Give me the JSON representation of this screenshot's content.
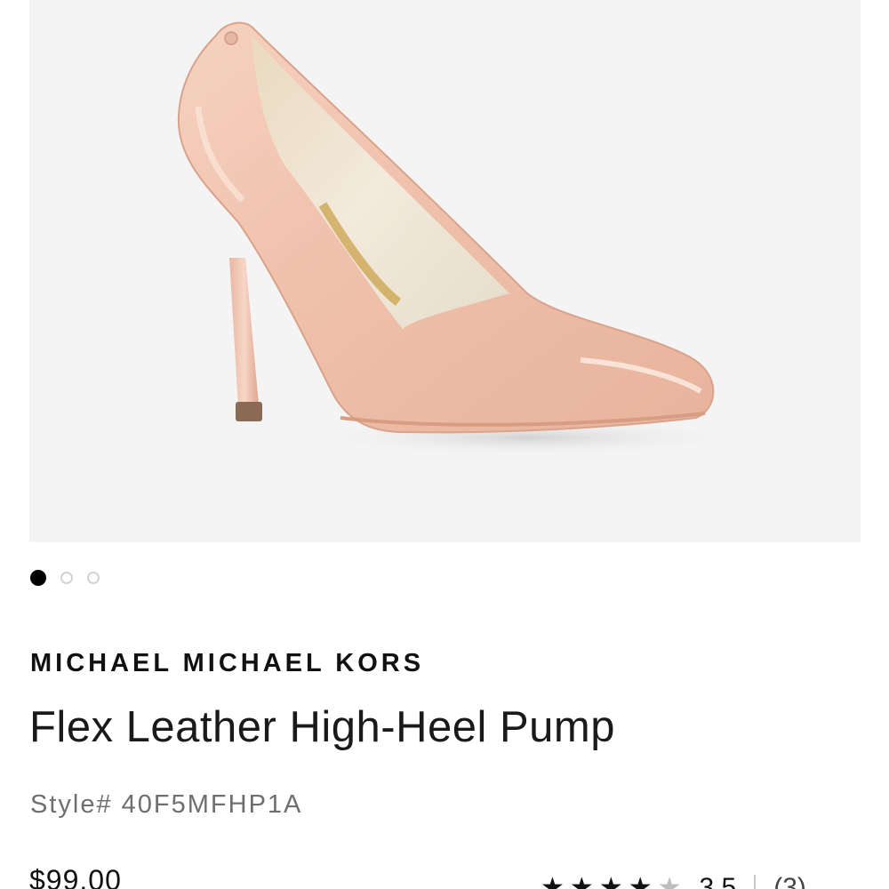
{
  "product": {
    "brand": "MICHAEL MICHAEL KORS",
    "name": "Flex Leather High-Heel Pump",
    "style_label": "Style#",
    "style_number": "40F5MFHP1A",
    "price": "$99.00",
    "image_description_icon": "pump-shoe-image",
    "color_swatch": "#f2c7b4"
  },
  "carousel": {
    "total": 3,
    "active_index": 0,
    "dots": [
      {
        "name": "image-1"
      },
      {
        "name": "image-2"
      },
      {
        "name": "image-3"
      }
    ]
  },
  "rating": {
    "value": "3.5",
    "stars": 3.5,
    "max_stars": 5,
    "review_count": "(3)"
  },
  "colors": {
    "image_background": "#f4f4f4",
    "active_dot": "#000000",
    "inactive_dot_border": "#d2d2d2",
    "brand_text": "#111111",
    "style_text": "#6f6f6f"
  }
}
